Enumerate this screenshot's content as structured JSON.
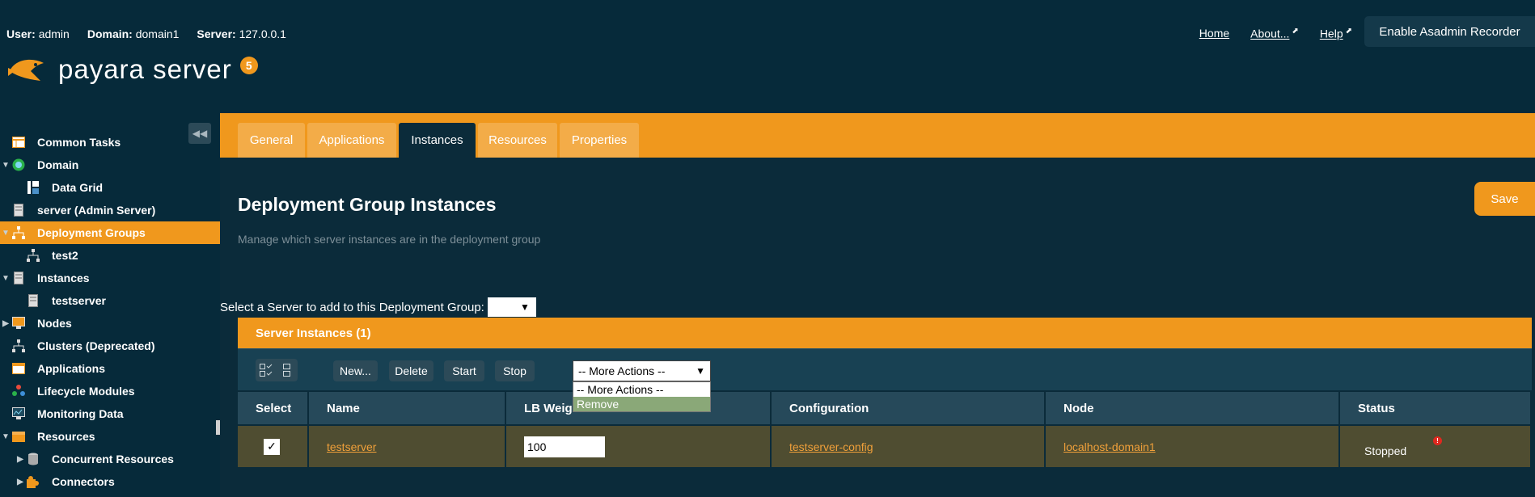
{
  "header": {
    "user_label": "User:",
    "user_value": "admin",
    "domain_label": "Domain:",
    "domain_value": "domain1",
    "server_label": "Server:",
    "server_value": "127.0.0.1",
    "links": {
      "home": "Home",
      "about": "About...",
      "help": "Help"
    },
    "recorder_button": "Enable Asadmin Recorder",
    "logo_text": "payara server",
    "logo_badge": "5"
  },
  "sidebar": {
    "items": [
      {
        "label": "Common Tasks",
        "icon": "table-icon"
      },
      {
        "label": "Domain",
        "icon": "globe-icon"
      },
      {
        "label": "Data Grid",
        "icon": "grid-icon"
      },
      {
        "label": "server (Admin Server)",
        "icon": "server-icon"
      },
      {
        "label": "Deployment Groups",
        "icon": "hierarchy-icon"
      },
      {
        "label": "test2",
        "icon": "hierarchy-icon"
      },
      {
        "label": "Instances",
        "icon": "server-icon"
      },
      {
        "label": "testserver",
        "icon": "server-icon"
      },
      {
        "label": "Nodes",
        "icon": "monitor-icon"
      },
      {
        "label": "Clusters (Deprecated)",
        "icon": "hierarchy-icon"
      },
      {
        "label": "Applications",
        "icon": "app-icon"
      },
      {
        "label": "Lifecycle Modules",
        "icon": "gear-icon"
      },
      {
        "label": "Monitoring Data",
        "icon": "monitor-icon"
      },
      {
        "label": "Resources",
        "icon": "box-icon"
      },
      {
        "label": "Concurrent Resources",
        "icon": "database-icon"
      },
      {
        "label": "Connectors",
        "icon": "puzzle-icon"
      }
    ]
  },
  "tabs": [
    "General",
    "Applications",
    "Instances",
    "Resources",
    "Properties"
  ],
  "page": {
    "title": "Deployment Group Instances",
    "description": "Manage which server instances are in the deployment group",
    "save_label": "Save",
    "add_server_label": "Select a Server to add to this Deployment Group:"
  },
  "table": {
    "title": "Server Instances (1)",
    "buttons": {
      "new": "New...",
      "delete": "Delete",
      "start": "Start",
      "stop": "Stop"
    },
    "more_actions": "-- More Actions --",
    "dropdown_options": [
      "-- More Actions --",
      "Remove"
    ],
    "columns": [
      "Select",
      "Name",
      "LB Weight",
      "Configuration",
      "Node",
      "Status"
    ],
    "rows": [
      {
        "selected": "✓",
        "name": "testserver",
        "lb_weight": "100",
        "configuration": "testserver-config",
        "node": "localhost-domain1",
        "status": "Stopped"
      }
    ]
  },
  "colors": {
    "accent": "#f0981d",
    "background": "#0b2b3a"
  }
}
